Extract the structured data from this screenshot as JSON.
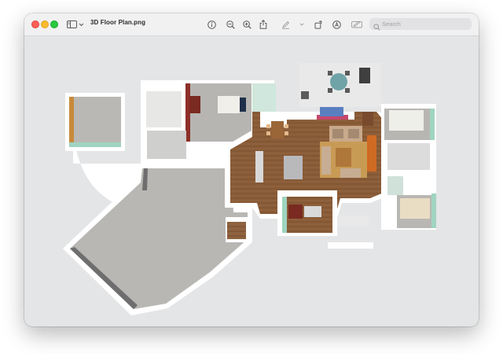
{
  "window": {
    "title": "3D Floor Plan.png",
    "traffic_lights": {
      "close": "#ff5f57",
      "minimize": "#febc2e",
      "zoom": "#28c840"
    }
  },
  "toolbar": {
    "sidebar_toggle_icon": "sidebar-icon",
    "sidebar_chevron_icon": "chevron-down-icon",
    "icons": [
      "info-icon",
      "zoom-out-icon",
      "zoom-in-icon",
      "share-icon",
      "markup-icon",
      "rotate-icon",
      "annotate-icon",
      "form-icon"
    ],
    "search_placeholder": "Search"
  },
  "floor_plan": {
    "description_colors": {
      "wood_floor": "#8a5c38",
      "carpet": "#b7b7b5",
      "wall": "#ffffff",
      "accent_wall": "#9fd4c0"
    }
  }
}
